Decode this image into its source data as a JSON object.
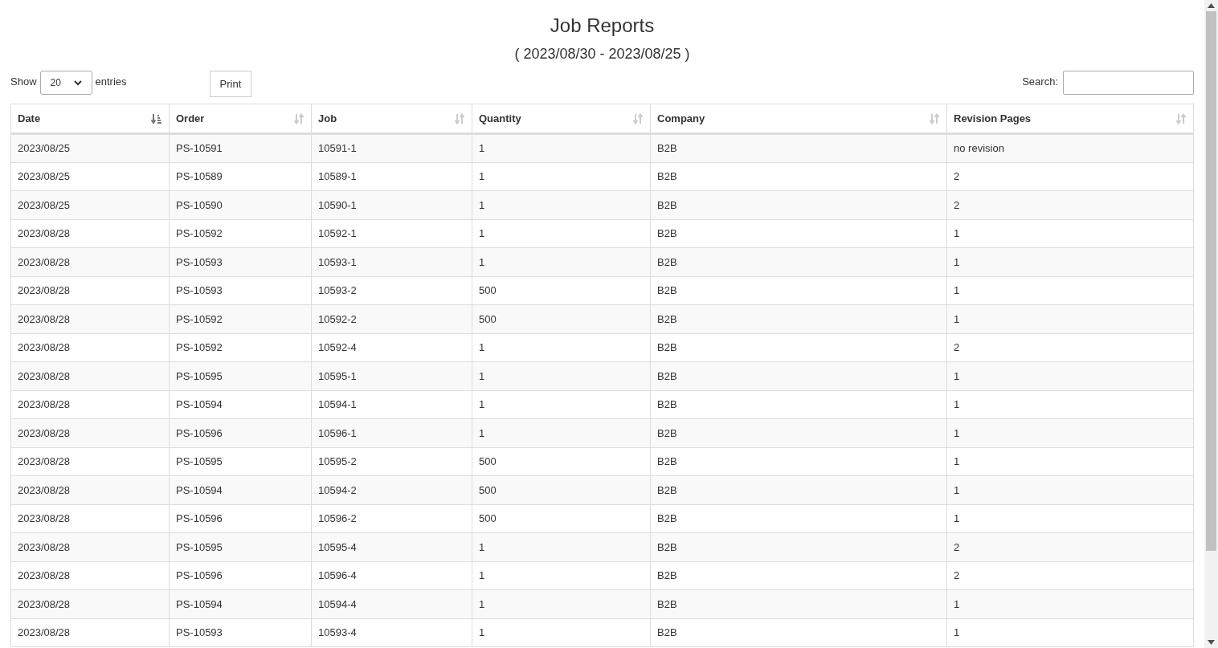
{
  "title": "Job Reports",
  "subtitle": "( 2023/08/30 - 2023/08/25 )",
  "length_menu": {
    "before": "Show",
    "value": "20",
    "after": "entries"
  },
  "print_button": "Print",
  "search": {
    "label": "Search:"
  },
  "table": {
    "columns": [
      {
        "label": "Date",
        "sorted": true
      },
      {
        "label": "Order",
        "sorted": false
      },
      {
        "label": "Job",
        "sorted": false
      },
      {
        "label": "Quantity",
        "sorted": false
      },
      {
        "label": "Company",
        "sorted": false
      },
      {
        "label": "Revision Pages",
        "sorted": false
      }
    ],
    "rows": [
      [
        "2023/08/25",
        "PS-10591",
        "10591-1",
        "1",
        "B2B",
        "no revision"
      ],
      [
        "2023/08/25",
        "PS-10589",
        "10589-1",
        "1",
        "B2B",
        "2"
      ],
      [
        "2023/08/25",
        "PS-10590",
        "10590-1",
        "1",
        "B2B",
        "2"
      ],
      [
        "2023/08/28",
        "PS-10592",
        "10592-1",
        "1",
        "B2B",
        "1"
      ],
      [
        "2023/08/28",
        "PS-10593",
        "10593-1",
        "1",
        "B2B",
        "1"
      ],
      [
        "2023/08/28",
        "PS-10593",
        "10593-2",
        "500",
        "B2B",
        "1"
      ],
      [
        "2023/08/28",
        "PS-10592",
        "10592-2",
        "500",
        "B2B",
        "1"
      ],
      [
        "2023/08/28",
        "PS-10592",
        "10592-4",
        "1",
        "B2B",
        "2"
      ],
      [
        "2023/08/28",
        "PS-10595",
        "10595-1",
        "1",
        "B2B",
        "1"
      ],
      [
        "2023/08/28",
        "PS-10594",
        "10594-1",
        "1",
        "B2B",
        "1"
      ],
      [
        "2023/08/28",
        "PS-10596",
        "10596-1",
        "1",
        "B2B",
        "1"
      ],
      [
        "2023/08/28",
        "PS-10595",
        "10595-2",
        "500",
        "B2B",
        "1"
      ],
      [
        "2023/08/28",
        "PS-10594",
        "10594-2",
        "500",
        "B2B",
        "1"
      ],
      [
        "2023/08/28",
        "PS-10596",
        "10596-2",
        "500",
        "B2B",
        "1"
      ],
      [
        "2023/08/28",
        "PS-10595",
        "10595-4",
        "1",
        "B2B",
        "2"
      ],
      [
        "2023/08/28",
        "PS-10596",
        "10596-4",
        "1",
        "B2B",
        "2"
      ],
      [
        "2023/08/28",
        "PS-10594",
        "10594-4",
        "1",
        "B2B",
        "1"
      ],
      [
        "2023/08/28",
        "PS-10593",
        "10593-4",
        "1",
        "B2B",
        "1"
      ]
    ]
  }
}
